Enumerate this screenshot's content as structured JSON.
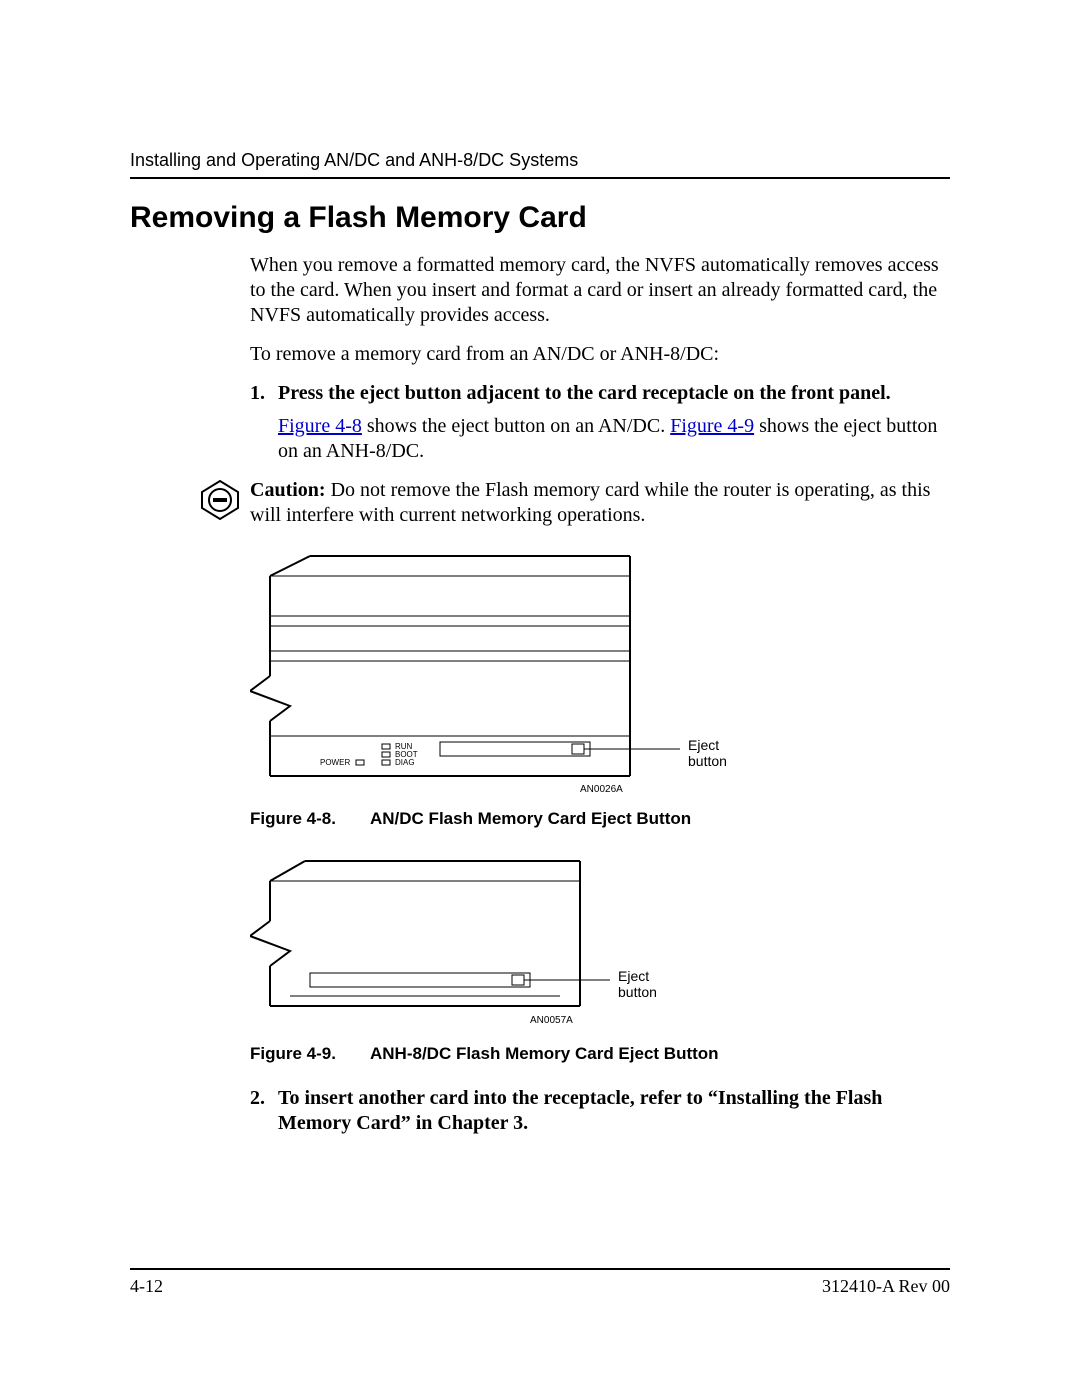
{
  "header": {
    "running_title": "Installing and Operating AN/DC and ANH-8/DC Systems"
  },
  "section": {
    "title": "Removing a Flash Memory Card",
    "intro_para": "When you remove a formatted memory card, the NVFS automatically removes access to the card. When you insert and format a card or insert an already formatted card, the NVFS automatically provides access.",
    "lead_para": "To remove a memory card from an AN/DC or ANH-8/DC:"
  },
  "steps": [
    {
      "num": "1.",
      "text": "Press the eject button adjacent to the card receptacle on the front panel.",
      "body_pre": "",
      "link1": "Figure 4-8",
      "body_mid": " shows the eject button on an AN/DC. ",
      "link2": "Figure 4-9",
      "body_post": " shows the eject button on an ANH-8/DC."
    },
    {
      "num": "2.",
      "text": "To insert another card into the receptacle, refer to “Installing the Flash Memory Card” in Chapter 3."
    }
  ],
  "caution": {
    "label": "Caution:",
    "text": " Do not remove the Flash memory card while the router is operating, as this will interfere with current networking operations."
  },
  "figures": {
    "fig1": {
      "number": "Figure 4-8.",
      "title": "AN/DC Flash Memory Card Eject Button",
      "labels": {
        "power": "POWER",
        "run": "RUN",
        "boot": "BOOT",
        "diag": "DIAG",
        "eject1": "Eject",
        "eject2": "button",
        "code": "AN0026A"
      }
    },
    "fig2": {
      "number": "Figure 4-9.",
      "title": "ANH-8/DC Flash Memory Card Eject Button",
      "labels": {
        "eject1": "Eject",
        "eject2": "button",
        "code": "AN0057A"
      }
    }
  },
  "footer": {
    "page": "4-12",
    "doc": "312410-A Rev 00"
  }
}
